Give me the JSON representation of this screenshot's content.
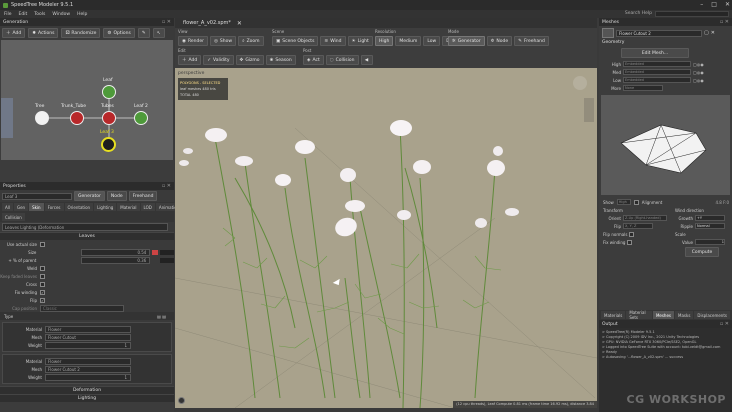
{
  "app": {
    "title": "SpeedTree  Modeler 9.5.1"
  },
  "menu": [
    "File",
    "Edit",
    "Tools",
    "Window",
    "Help"
  ],
  "search": {
    "label": "Search Help"
  },
  "generation": {
    "panel_title": "Generation",
    "buttons": [
      "Add",
      "Actions",
      "Randomize",
      "Options"
    ],
    "nodes": {
      "tree": "Tree",
      "trunk": "Trunk_Tube",
      "tubes": "Tubes",
      "leaf_top": "Leaf",
      "leaf2": "Leaf 2",
      "leaf3": "Leaf 3"
    }
  },
  "properties": {
    "panel_title": "Properties",
    "object_name": "Leaf 3",
    "mode_buttons": [
      "Generator",
      "Node",
      "Freehand"
    ],
    "tabs": [
      "All",
      "Gen",
      "Skin",
      "Forces",
      "Orientation",
      "Lighting",
      "Material",
      "LOD",
      "Animation"
    ],
    "tab2": "Collision",
    "lod_header": "Leaves Lighting (Deformation",
    "section_leaves": "Leaves",
    "rows": [
      {
        "label": "Use actual size",
        "value": ""
      },
      {
        "label": "Size",
        "value": "0.54"
      },
      {
        "label": "+ % of parent",
        "value": "0.36"
      },
      {
        "label": "Weld",
        "value": ""
      },
      {
        "label": "Keep faded leaves",
        "value": ""
      },
      {
        "label": "Cross",
        "value": ""
      },
      {
        "label": "Fix winding",
        "value": ""
      },
      {
        "label": "Flip",
        "value": ""
      },
      {
        "label": "Cap position",
        "value": "Classic"
      }
    ],
    "type_label": "Type",
    "type_blocks": [
      {
        "material_label": "Material",
        "material": "Flower",
        "mesh_label": "Mesh",
        "mesh": "Flower Cutout",
        "weight_label": "Weight",
        "weight": "1"
      },
      {
        "material_label": "Material",
        "material": "Flower",
        "mesh_label": "Mesh",
        "mesh": "Flower Cutout 2",
        "weight_label": "Weight",
        "weight": "1"
      }
    ],
    "sections": [
      "Deformation",
      "Lighting"
    ]
  },
  "document": {
    "tab": "flower_A_v02.spm*"
  },
  "toolbar": {
    "view_group": "View",
    "view_buttons": [
      "Render",
      "Show",
      "Zoom"
    ],
    "scene_group": "Scene",
    "scene_buttons": [
      "Scene Objects",
      "Wind",
      "Light"
    ],
    "res_group": "Resolution",
    "res_buttons": [
      "High",
      "Medium",
      "Low",
      "Draft"
    ],
    "mode_group": "Mode",
    "mode_buttons": [
      "Generator",
      "Node",
      "Freehand"
    ],
    "edit_group": "Edit",
    "edit_buttons": [
      "Add",
      "Validity",
      "Gizmo",
      "Season"
    ],
    "post_group": "Post",
    "post_buttons": [
      "Act",
      "Collision"
    ]
  },
  "viewport": {
    "camera": "perspective",
    "hud_title": "POLYGONS - SELECTED",
    "hud_line1": "leaf meshes   480 tris",
    "hud_line2": "TOTAL   480",
    "status": "(12 cpu threads), Leaf Compute 0.81 ms (frame time 16.92 ms), distance 3.84"
  },
  "meshes": {
    "panel_title": "Meshes",
    "selected_mesh": "Flower Cutout 2",
    "geometry_label": "Geometry",
    "edit_mesh_button": "Edit Mesh...",
    "lod_rows": [
      {
        "label": "High",
        "value": "Embedded"
      },
      {
        "label": "Med",
        "value": "Embedded"
      },
      {
        "label": "Low",
        "value": "Embedded"
      },
      {
        "label": "More",
        "value": "None"
      }
    ],
    "show_label": "Show",
    "show_value": "High",
    "alignment_label": "Alignment",
    "preview_stat": "4.8  F:0",
    "transform_label": "Transform",
    "orient_label": "Orient",
    "orient_value": "Z-Up (Right-handed)",
    "flip_label": "Flip",
    "flip_value": "X, Y, Z",
    "flip_normals": "Flip normals",
    "fix_winding": "Fix winding",
    "wind_label": "Wind direction",
    "growth_label": "Growth",
    "growth_value": "+Y",
    "ripple_label": "Ripple",
    "ripple_value": "Normal",
    "scale_label": "Scale",
    "scale_value_label": "Value",
    "scale_value": "1",
    "compute_button": "Compute",
    "bottom_tabs": [
      "Materials",
      "Material Sets",
      "Meshes",
      "Masks",
      "Displacements"
    ]
  },
  "output": {
    "panel_title": "Output",
    "lines": [
      "> SpeedTree(R) Modeler 9.5.1",
      "> Copyright (C) 2009 IDV Inc., 2021 Unity Technologies",
      "",
      "> GPU: NVIDIA GeForce RTX 3060/PCIe/SSE2, OpenGL",
      "",
      "> Logged into SpeedTree Suite with account: tobi.veldt@gmail.com",
      "",
      "> Ready",
      "> Autosaving '...flower_A_v02.spm' ... success"
    ]
  },
  "watermark": "CG WORKSHOP",
  "colors": {
    "accent_yellow": "#e8e020",
    "node_red": "#b8282a",
    "viewport_bg": "#a9a28c"
  }
}
